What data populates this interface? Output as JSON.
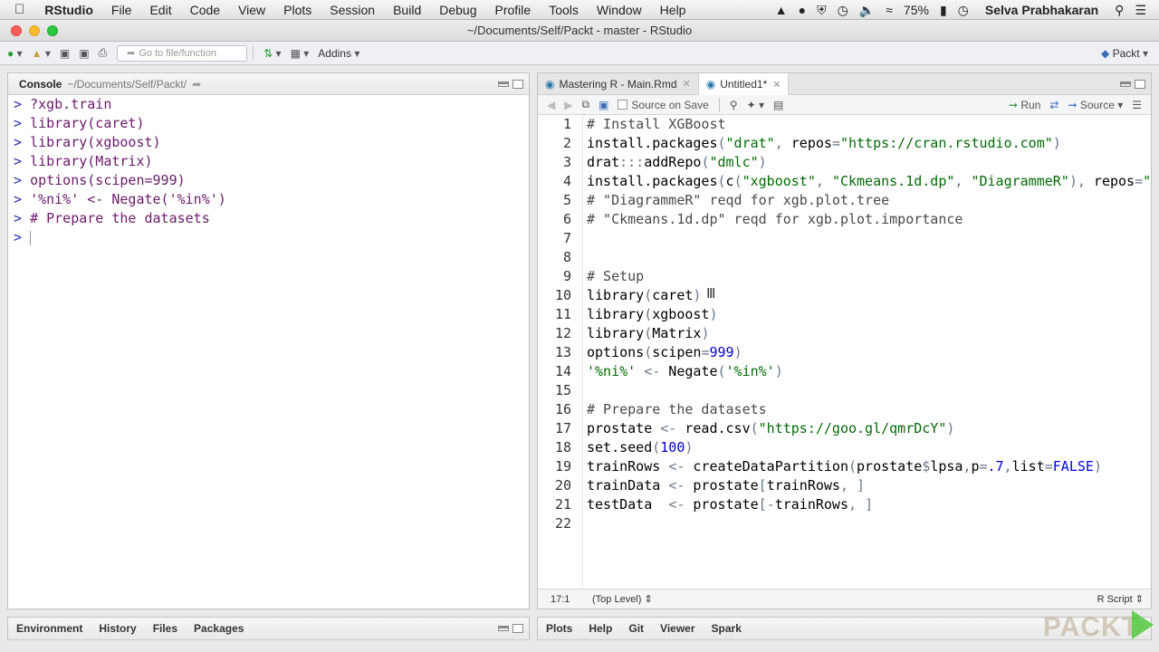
{
  "menubar": {
    "app": "RStudio",
    "items": [
      "File",
      "Edit",
      "Code",
      "View",
      "Plots",
      "Session",
      "Build",
      "Debug",
      "Profile",
      "Tools",
      "Window",
      "Help"
    ],
    "battery": "75%",
    "user": "Selva Prabhakaran"
  },
  "window": {
    "title": "~/Documents/Self/Packt - master - RStudio"
  },
  "toolbar": {
    "goto_placeholder": "Go to file/function",
    "addins": "Addins",
    "project": "Packt"
  },
  "console": {
    "title": "Console",
    "path": "~/Documents/Self/Packt/",
    "lines": [
      "?xgb.train",
      "library(caret)",
      "library(xgboost)",
      "library(Matrix)",
      "options(scipen=999)",
      "'%ni%' <- Negate('%in%')",
      "# Prepare the datasets",
      ""
    ],
    "prompt": ">"
  },
  "editor": {
    "tabs": [
      {
        "label": "Mastering R - Main.Rmd",
        "active": false
      },
      {
        "label": "Untitled1*",
        "active": true
      }
    ],
    "source_on_save": "Source on Save",
    "run": "Run",
    "source": "Source",
    "position": "17:1",
    "scope": "(Top Level)",
    "filetype": "R Script",
    "code": [
      "# Install XGBoost",
      "install.packages(\"drat\", repos=\"https://cran.rstudio.com\")",
      "drat:::addRepo(\"dmlc\")",
      "install.packages(c(\"xgboost\", \"Ckmeans.1d.dp\", \"DiagrammeR\"), repos=\"http://dmlc.ml/drat/\", type = \"source\")",
      "# \"DiagrammeR\" reqd for xgb.plot.tree",
      "# \"Ckmeans.1d.dp\" reqd for xgb.plot.importance",
      "",
      "",
      "# Setup",
      "library(caret)",
      "library(xgboost)",
      "library(Matrix)",
      "options(scipen=999)",
      "'%ni%' <- Negate('%in%')",
      "",
      "# Prepare the datasets",
      "prostate <- read.csv(\"https://goo.gl/qmrDcY\")",
      "set.seed(100)",
      "trainRows <- createDataPartition(prostate$lpsa,p=.7,list=FALSE)",
      "trainData <- prostate[trainRows, ]",
      "testData  <- prostate[-trainRows, ]",
      ""
    ]
  },
  "env_pane": {
    "tabs": [
      "Environment",
      "History",
      "Files",
      "Packages"
    ]
  },
  "files_pane": {
    "tabs": [
      "Plots",
      "Help",
      "Git",
      "Viewer",
      "Spark"
    ]
  },
  "watermark": {
    "text": "PACKT"
  }
}
